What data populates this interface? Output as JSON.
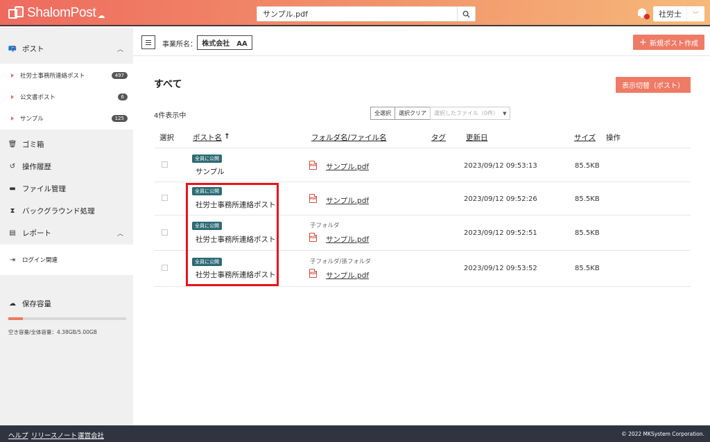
{
  "header": {
    "logo_text": "ShalomPost",
    "search_value": "サンプル.pdf",
    "user": "社労士"
  },
  "sidebar": {
    "post": {
      "label": "ポスト",
      "items": [
        {
          "label": "社労士事務所連絡ポスト",
          "count": "497"
        },
        {
          "label": "公文書ポスト",
          "count": "6"
        },
        {
          "label": "サンプル",
          "count": "125"
        }
      ]
    },
    "trash": "ゴミ箱",
    "history": "操作履歴",
    "file_mgmt": "ファイル管理",
    "background": "バックグラウンド処理",
    "report": {
      "label": "レポート",
      "items": [
        {
          "label": "ログイン関連"
        }
      ]
    },
    "storage": {
      "label": "保存容量",
      "text": "空き容量/全体容量：4.38GB/5.00GB",
      "used_fraction": 0.124
    }
  },
  "toolbar": {
    "office_label": "事業所名：",
    "office_value": "株式会社　AA",
    "new_post_label": "新規ポスト作成"
  },
  "main": {
    "title": "すべて",
    "toggle_label": "表示切替（ポスト）",
    "count_text": "4件表示中",
    "select_all": "全選択",
    "clear_selection": "選択クリア",
    "selected_files": "選択したファイル（0件）"
  },
  "table": {
    "headers": {
      "select": "選択",
      "post_name": "ポスト名",
      "sort_arrow": "↑",
      "folder_file": "フォルダ名/ファイル名",
      "tag": "タグ",
      "updated": "更新日",
      "size": "サイズ",
      "actions": "操作"
    },
    "rows": [
      {
        "badge": "全員に公開",
        "post": "サンプル",
        "folder": "",
        "file": "サンプル.pdf",
        "date": "2023/09/12 09:53:13",
        "size": "85.5KB"
      },
      {
        "badge": "全員に公開",
        "post": "社労士事務所連絡ポスト",
        "folder": "",
        "file": "サンプル.pdf",
        "date": "2023/09/12 09:52:26",
        "size": "85.5KB"
      },
      {
        "badge": "全員に公開",
        "post": "社労士事務所連絡ポスト",
        "folder": "子フォルダ",
        "file": "サンプル.pdf",
        "date": "2023/09/12 09:52:51",
        "size": "85.5KB"
      },
      {
        "badge": "全員に公開",
        "post": "社労士事務所連絡ポスト",
        "folder": "子フォルダ/孫フォルダ",
        "file": "サンプル.pdf",
        "date": "2023/09/12 09:53:52",
        "size": "85.5KB"
      }
    ],
    "pdf_icon_text": "PDF"
  },
  "footer": {
    "help": "ヘルプ",
    "release_notes": "リリースノート",
    "company": "運営会社",
    "copyright": "© 2022 MKSystem Corporation."
  },
  "colors": {
    "accent": "#ee7b66",
    "badge": "#2d6b74",
    "highlight": "#e8131a",
    "footer": "#2f3440"
  }
}
